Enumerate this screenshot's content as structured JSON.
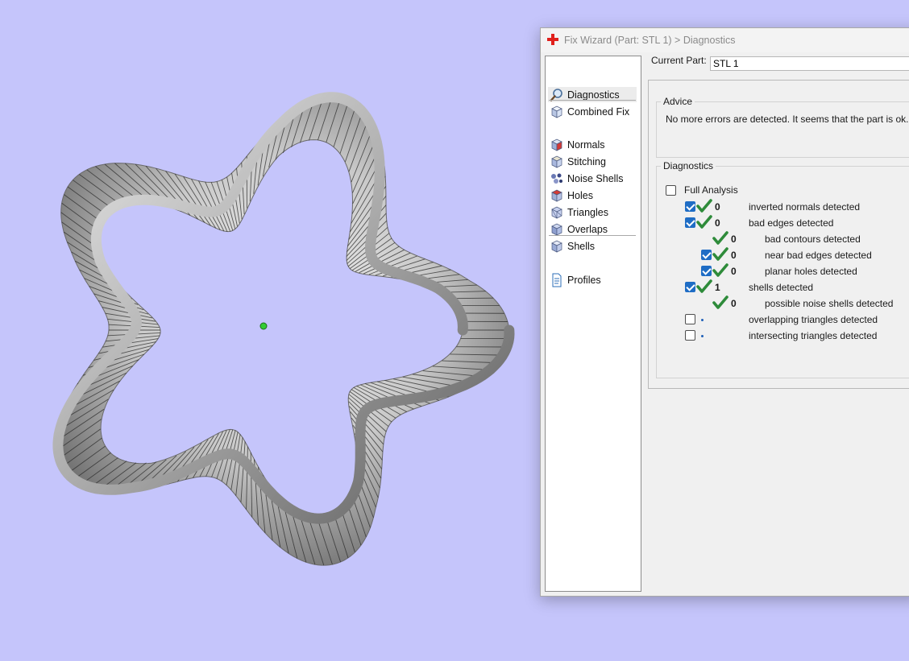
{
  "window": {
    "title": "Fix Wizard (Part: STL 1) > Diagnostics",
    "icon": "red-cross-icon",
    "accent": "#e0201c"
  },
  "viewport": {
    "background": "#c5c5fb",
    "model_icon": "twisted-ring-model",
    "pivot_color": "#33cc33"
  },
  "nav": {
    "top_items": [
      {
        "label": "Diagnostics",
        "icon": "magnifier-icon",
        "selected": true
      },
      {
        "label": "Combined Fix",
        "icon": "cube-fix-icon",
        "selected": false
      }
    ],
    "fix_items": [
      {
        "label": "Normals",
        "icon": "normals-cube-icon"
      },
      {
        "label": "Stitching",
        "icon": "stitching-cube-icon"
      },
      {
        "label": "Noise Shells",
        "icon": "noise-shells-icon"
      },
      {
        "label": "Holes",
        "icon": "holes-cube-icon"
      },
      {
        "label": "Triangles",
        "icon": "triangles-cube-icon"
      },
      {
        "label": "Overlaps",
        "icon": "overlaps-cube-icon"
      },
      {
        "label": "Shells",
        "icon": "shells-cube-icon"
      }
    ],
    "bottom_items": [
      {
        "label": "Profiles",
        "icon": "document-icon"
      }
    ]
  },
  "current_part": {
    "label": "Current Part:",
    "value": "STL 1"
  },
  "advice": {
    "title": "Advice",
    "text": "No more errors are detected. It seems that the part is ok. Note"
  },
  "diagnostics": {
    "title": "Diagnostics",
    "full_analysis_label": "Full Analysis",
    "full_analysis_checked": false,
    "rows": [
      {
        "label": "inverted normals detected",
        "count": "0",
        "checkbox": true,
        "checked": true,
        "status": "ok",
        "indent": 0
      },
      {
        "label": "bad edges detected",
        "count": "0",
        "checkbox": true,
        "checked": true,
        "status": "ok",
        "indent": 0
      },
      {
        "label": "bad contours detected",
        "count": "0",
        "checkbox": false,
        "checked": false,
        "status": "ok",
        "indent": 1
      },
      {
        "label": "near bad edges detected",
        "count": "0",
        "checkbox": true,
        "checked": true,
        "status": "ok",
        "indent": 1
      },
      {
        "label": "planar holes detected",
        "count": "0",
        "checkbox": true,
        "checked": true,
        "status": "ok",
        "indent": 1
      },
      {
        "label": "shells detected",
        "count": "1",
        "checkbox": true,
        "checked": true,
        "status": "ok",
        "indent": 0
      },
      {
        "label": "possible noise shells detected",
        "count": "0",
        "checkbox": false,
        "checked": false,
        "status": "ok",
        "indent": 1
      },
      {
        "label": "overlapping triangles detected",
        "count": "",
        "checkbox": true,
        "checked": false,
        "status": "none",
        "indent": 0
      },
      {
        "label": "intersecting triangles detected",
        "count": "",
        "checkbox": true,
        "checked": false,
        "status": "none",
        "indent": 0
      }
    ]
  },
  "colors": {
    "check_green": "#2e8b3a",
    "checkbox_blue": "#1f6dc5"
  }
}
